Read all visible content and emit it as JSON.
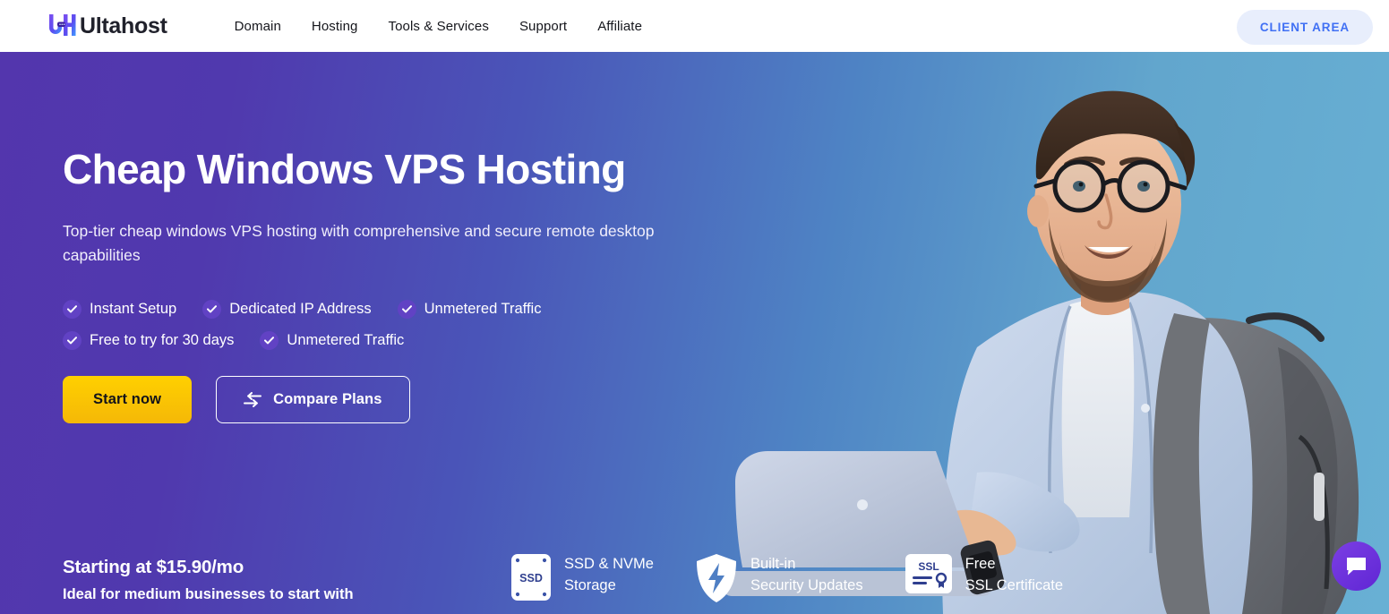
{
  "header": {
    "logo_text": "Ultahost",
    "logo_icon": "ultahost-uh-monogram",
    "nav": [
      {
        "label": "Domain"
      },
      {
        "label": "Hosting"
      },
      {
        "label": "Tools & Services"
      },
      {
        "label": "Support"
      },
      {
        "label": "Affiliate"
      }
    ],
    "client_area_label": "CLIENT AREA"
  },
  "hero": {
    "title": "Cheap Windows VPS Hosting",
    "subtitle": "Top-tier cheap windows VPS hosting with comprehensive and secure remote desktop capabilities",
    "features_row1": [
      {
        "label": "Instant Setup",
        "icon": "check-icon"
      },
      {
        "label": "Dedicated IP Address",
        "icon": "check-icon"
      },
      {
        "label": "Unmetered Traffic",
        "icon": "check-icon"
      }
    ],
    "features_row2": [
      {
        "label": "Free to try for 30 days",
        "icon": "check-icon"
      },
      {
        "label": "Unmetered Traffic",
        "icon": "check-icon"
      }
    ],
    "cta_primary": "Start now",
    "cta_secondary": "Compare Plans",
    "cta_secondary_icon": "compare-swap-arrows-icon"
  },
  "pricing": {
    "headline": "Starting at $15.90/mo",
    "subline": "Ideal for medium businesses to start with"
  },
  "badges": [
    {
      "icon": "ssd-drive-icon",
      "icon_label": "SSD",
      "text": "SSD & NVMe\nStorage"
    },
    {
      "icon": "shield-bolt-icon",
      "text": "Built-in\nSecurity Updates"
    },
    {
      "icon": "ssl-certificate-icon",
      "icon_label": "SSL",
      "text": "Free\nSSL Certificate"
    }
  ],
  "chat": {
    "icon": "chat-bubble-icon"
  },
  "colors": {
    "hero_gradient_start": "#5336ad",
    "hero_gradient_end": "#68b0d4",
    "accent_yellow": "#ffd000",
    "client_area_bg": "#e8eefc",
    "client_area_text": "#4070f4",
    "check_circle": "#6142c4",
    "chat_fab": "#6026d4"
  }
}
